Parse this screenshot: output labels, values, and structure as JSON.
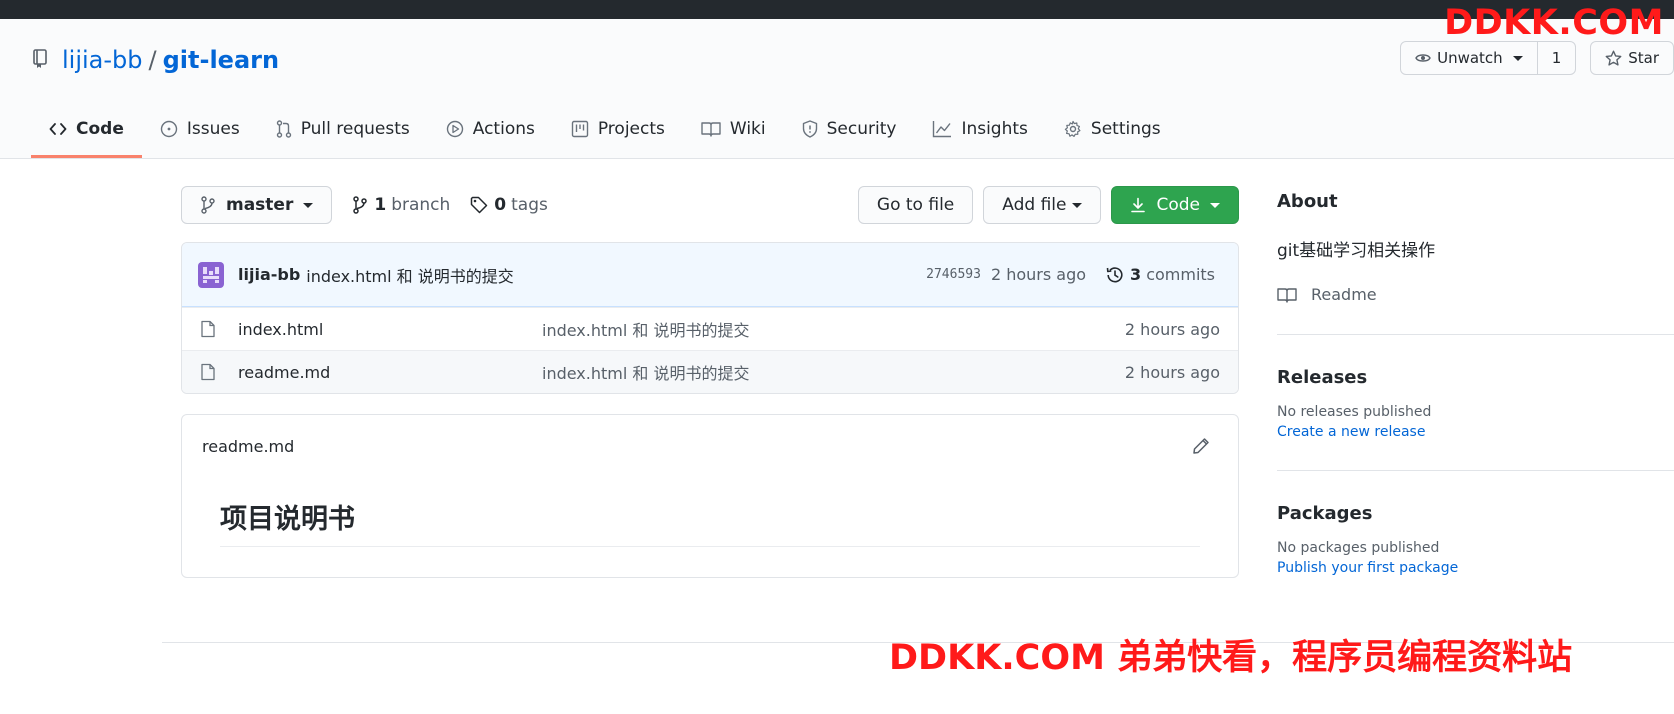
{
  "repo": {
    "owner": "lijia-bb",
    "separator": "/",
    "name": "git-learn"
  },
  "actions": {
    "watch_label": "Unwatch",
    "watch_count": "1",
    "star_label": "Star"
  },
  "tabs": [
    {
      "label": "Code",
      "icon": "code-icon",
      "selected": true
    },
    {
      "label": "Issues",
      "icon": "issue-icon"
    },
    {
      "label": "Pull requests",
      "icon": "pull-request-icon"
    },
    {
      "label": "Actions",
      "icon": "play-icon"
    },
    {
      "label": "Projects",
      "icon": "project-icon"
    },
    {
      "label": "Wiki",
      "icon": "book-icon"
    },
    {
      "label": "Security",
      "icon": "shield-icon"
    },
    {
      "label": "Insights",
      "icon": "graph-icon"
    },
    {
      "label": "Settings",
      "icon": "gear-icon"
    }
  ],
  "file_nav": {
    "branch": "master",
    "branch_count": "1",
    "branch_word": "branch",
    "tag_count": "0",
    "tag_word": "tags",
    "go_to_file": "Go to file",
    "add_file": "Add file",
    "code_button": "Code"
  },
  "commit": {
    "author": "lijia-bb",
    "message": "index.html 和 说明书的提交",
    "sha": "2746593",
    "time": "2 hours ago",
    "count": "3",
    "count_word": "commits"
  },
  "files": [
    {
      "name": "index.html",
      "message": "index.html 和 说明书的提交",
      "age": "2 hours ago"
    },
    {
      "name": "readme.md",
      "message": "index.html 和 说明书的提交",
      "age": "2 hours ago"
    }
  ],
  "readme": {
    "filename": "readme.md",
    "heading": "项目说明书"
  },
  "sidebar": {
    "about_title": "About",
    "description": "git基础学习相关操作",
    "readme_link": "Readme",
    "releases_title": "Releases",
    "releases_none": "No releases published",
    "releases_link": "Create a new release",
    "packages_title": "Packages",
    "packages_none": "No packages published",
    "packages_link": "Publish your first package"
  },
  "watermarks": {
    "top": "DDKK.COM",
    "bottom": "DDKK.COM 弟弟快看，程序员编程资料站"
  },
  "colors": {
    "link": "#0366d6",
    "primary_button": "#2ea44f",
    "selected_tab_underline": "#f9826c",
    "watermark": "#ff1a1a"
  }
}
